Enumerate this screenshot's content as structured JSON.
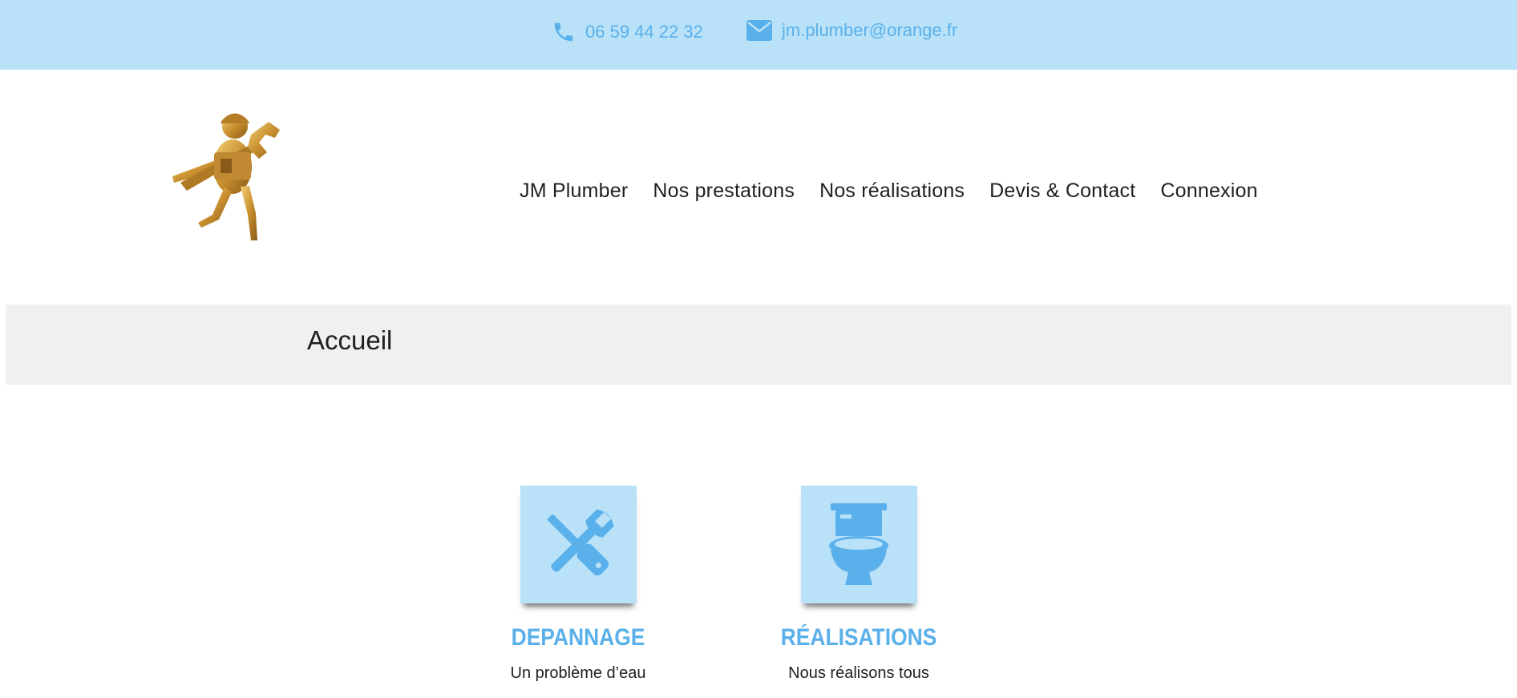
{
  "topbar": {
    "phone": "06 59 44 22 32",
    "email": "jm.plumber@orange.fr",
    "phone_icon": "phone-icon",
    "email_icon": "envelope-icon",
    "color_bg": "#b9e2f9",
    "color_text": "#5ab0ea"
  },
  "nav": {
    "items": [
      {
        "label": "JM Plumber"
      },
      {
        "label": "Nos prestations"
      },
      {
        "label": "Nos réalisations"
      },
      {
        "label": "Devis & Contact"
      },
      {
        "label": "Connexion"
      }
    ]
  },
  "breadcrumb": {
    "title": "Accueil"
  },
  "cards": [
    {
      "icon": "wrench-screwdriver-icon",
      "title": "DEPANNAGE",
      "text": "Un problème d’eau"
    },
    {
      "icon": "toilet-icon",
      "title": "RÉALISATIONS",
      "text": "Nous réalisons tous"
    }
  ]
}
